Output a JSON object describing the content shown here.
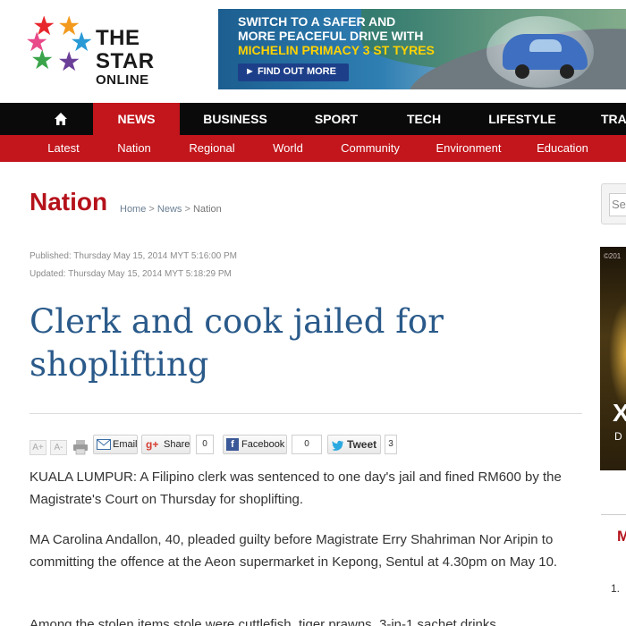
{
  "logo": {
    "line1": "THE STAR",
    "line2": "ONLINE"
  },
  "banner": {
    "line1": "SWITCH TO A SAFER AND",
    "line2": "MORE PEACEFUL DRIVE WITH",
    "line3": "MICHELIN PRIMACY 3 ST TYRES",
    "button": "► FIND OUT MORE"
  },
  "nav": {
    "items": [
      "NEWS",
      "BUSINESS",
      "SPORT",
      "TECH",
      "LIFESTYLE",
      "TRA"
    ]
  },
  "subnav": {
    "items": [
      "Latest",
      "Nation",
      "Regional",
      "World",
      "Community",
      "Environment",
      "Education"
    ]
  },
  "section": {
    "title": "Nation",
    "breadcrumb": [
      "Home",
      "News",
      "Nation"
    ]
  },
  "article": {
    "published": "Published: Thursday May 15, 2014 MYT 5:16:00 PM",
    "updated": "Updated: Thursday May 15, 2014 MYT 5:18:29 PM",
    "headline_line1": "Clerk and cook jailed for",
    "headline_line2": "shoplifting",
    "paragraphs": [
      "KUALA LUMPUR: A Filipino clerk was sentenced to one day's jail and fined RM600 by the Magistrate's Court on Thursday for shoplifting.",
      "MA Carolina Andallon, 40, pleaded guilty before Magistrate Erry Shahriman Nor Aripin to committing the offence at the Aeon supermarket in Kepong, Sentul at 4.30pm on May 10.",
      "Among the stolen items stole were cuttlefish, tiger prawns, 3-in-1 sachet drinks"
    ]
  },
  "tools": {
    "font_increase": "A+",
    "font_decrease": "A-",
    "email": "Email",
    "share": "Share",
    "share_count": "0",
    "facebook": "Facebook",
    "facebook_count": "0",
    "tweet": "Tweet",
    "tweet_count": "3"
  },
  "sidebar": {
    "search_placeholder": "Sea",
    "ad_tag": "©201",
    "ad_letters": "X",
    "ad_sub": "D",
    "heading": "M",
    "list_num": "1."
  },
  "colors": {
    "brand_red": "#c2161c",
    "nav_black": "#0a0a0a",
    "headline_blue": "#2a5a8a"
  }
}
